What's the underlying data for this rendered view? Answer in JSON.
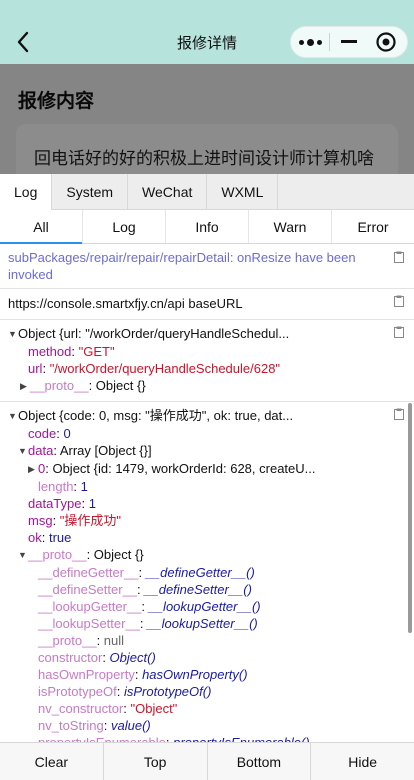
{
  "header": {
    "title": "报修详情",
    "back_icon": "chevron-left-icon",
    "capsule_icons": [
      "more-icon",
      "minimize-icon",
      "close-target-icon"
    ],
    "background": "#b6e3dc"
  },
  "page": {
    "section_title": "报修内容",
    "content_text": "回电话好的好的积极上进时间设计师计算机啥"
  },
  "vconsole": {
    "tabs": [
      {
        "label": "Log",
        "active": true
      },
      {
        "label": "System",
        "active": false
      },
      {
        "label": "WeChat",
        "active": false
      },
      {
        "label": "WXML",
        "active": false
      }
    ],
    "subtabs": [
      {
        "label": "All",
        "active": true
      },
      {
        "label": "Log",
        "active": false
      },
      {
        "label": "Info",
        "active": false
      },
      {
        "label": "Warn",
        "active": false
      },
      {
        "label": "Error",
        "active": false
      }
    ],
    "logs": {
      "log1": "subPackages/repair/repair/repairDetail: onResize have been invoked",
      "log2": "https://console.smartxfjy.cn/api baseURL",
      "obj1": {
        "summary": "Object {url: \"/workOrder/queryHandleSchedul...",
        "method_key": "method",
        "method_val": "\"GET\"",
        "url_key": "url",
        "url_val": "\"/workOrder/queryHandleSchedule/628\"",
        "proto_key": "__proto__",
        "proto_val": "Object {}"
      },
      "obj2": {
        "summary": "Object {code: 0, msg: \"操作成功\", ok: true, dat...",
        "code_key": "code",
        "code_val": "0",
        "data_key": "data",
        "data_val": "Array [Object {}]",
        "item0_key": "0",
        "item0_val": "Object {id: 1479, workOrderId: 628, createU...",
        "length_key": "length",
        "length_val": "1",
        "datatype_key": "dataType",
        "datatype_val": "1",
        "msg_key": "msg",
        "msg_val": "\"操作成功\"",
        "ok_key": "ok",
        "ok_val": "true",
        "proto_key": "__proto__",
        "proto_val": "Object {}",
        "proto_members": [
          {
            "key": "__defineGetter__",
            "val": "__defineGetter__()",
            "kind": "fn"
          },
          {
            "key": "__defineSetter__",
            "val": "__defineSetter__()",
            "kind": "fn"
          },
          {
            "key": "__lookupGetter__",
            "val": "__lookupGetter__()",
            "kind": "fn"
          },
          {
            "key": "__lookupSetter__",
            "val": "__lookupSetter__()",
            "kind": "fn"
          },
          {
            "key": "__proto__",
            "val": "null",
            "kind": "nul"
          },
          {
            "key": "constructor",
            "val": "Object()",
            "kind": "fn"
          },
          {
            "key": "hasOwnProperty",
            "val": "hasOwnProperty()",
            "kind": "fn"
          },
          {
            "key": "isPrototypeOf",
            "val": "isPrototypeOf()",
            "kind": "fn"
          },
          {
            "key": "nv_constructor",
            "val": "\"Object\"",
            "kind": "str"
          },
          {
            "key": "nv_toString",
            "val": "value()",
            "kind": "fn"
          },
          {
            "key": "propertyIsEnumerable",
            "val": "propertyIsEnumerable()",
            "kind": "fn"
          }
        ]
      }
    },
    "toolbar": {
      "clear": "Clear",
      "top": "Top",
      "bottom": "Bottom",
      "hide": "Hide"
    },
    "accent": "#2b8ef4"
  }
}
